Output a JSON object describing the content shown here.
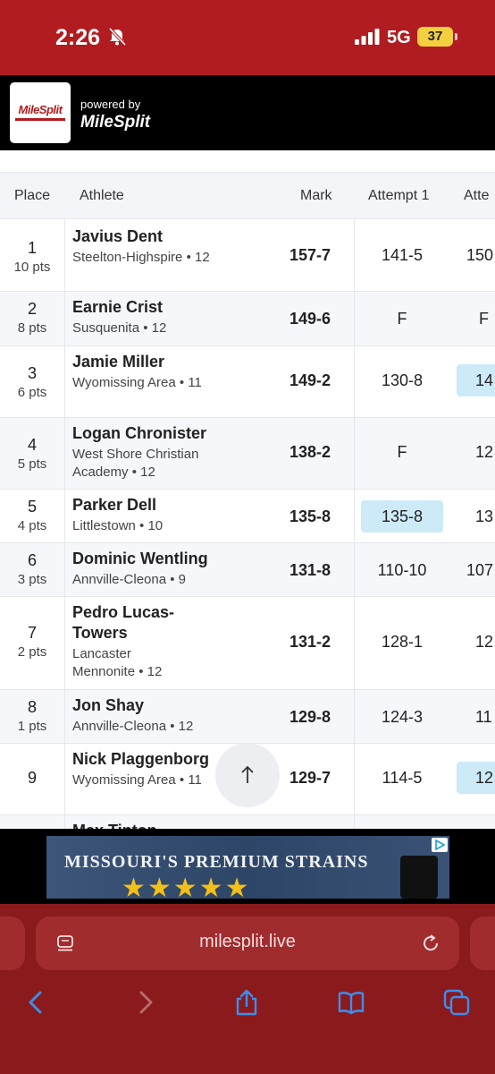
{
  "status_bar": {
    "time": "2:26",
    "network": "5G",
    "battery": "37"
  },
  "header": {
    "logo_text": "MileSplit",
    "powered_by": "powered by",
    "powered_brand": "MileSplit"
  },
  "table": {
    "columns": {
      "place": "Place",
      "athlete": "Athlete",
      "mark": "Mark",
      "attempt1": "Attempt 1",
      "attempt2": "Atte"
    },
    "rows": [
      {
        "place": "1",
        "pts": "10 pts",
        "name": "Javius Dent",
        "team": "Steelton-Highspire • 12",
        "mark": "157-7",
        "att1": "141-5",
        "att2": "150"
      },
      {
        "place": "2",
        "pts": "8 pts",
        "name": "Earnie Crist",
        "team": "Susquenita • 12",
        "mark": "149-6",
        "att1": "F",
        "att2": "F"
      },
      {
        "place": "3",
        "pts": "6 pts",
        "name": "Jamie Miller",
        "team": "Wyomissing Area • 11",
        "mark": "149-2",
        "att1": "130-8",
        "att2": "14"
      },
      {
        "place": "4",
        "pts": "5 pts",
        "name": "Logan Chronister",
        "team": "West Shore Christian Academy • 12",
        "mark": "138-2",
        "att1": "F",
        "att2": "12"
      },
      {
        "place": "5",
        "pts": "4 pts",
        "name": "Parker Dell",
        "team": "Littlestown • 10",
        "mark": "135-8",
        "att1": "135-8",
        "att2": "13"
      },
      {
        "place": "6",
        "pts": "3 pts",
        "name": "Dominic Wentling",
        "team": "Annville-Cleona • 9",
        "mark": "131-8",
        "att1": "110-10",
        "att2": "107"
      },
      {
        "place": "7",
        "pts": "2 pts",
        "name": "Pedro Lucas-Towers",
        "team": "Lancaster Mennonite • 12",
        "mark": "131-2",
        "att1": "128-1",
        "att2": "12"
      },
      {
        "place": "8",
        "pts": "1 pts",
        "name": "Jon Shay",
        "team": "Annville-Cleona • 12",
        "mark": "129-8",
        "att1": "124-3",
        "att2": "11"
      },
      {
        "place": "9",
        "pts": "",
        "name": "Nick Plaggenborg",
        "team": "Wyomissing Area • 11",
        "mark": "129-7",
        "att1": "114-5",
        "att2": "12"
      },
      {
        "place": "",
        "pts": "",
        "name": "Max Tinton",
        "team": "",
        "mark": "",
        "att1": "",
        "att2": ""
      }
    ]
  },
  "ad": {
    "text": "MISSOURI'S PREMIUM STRAINS",
    "stars": "★★★★★"
  },
  "browser": {
    "url": "milesplit.live"
  },
  "colors": {
    "status_bar": "#b01c1f",
    "browser_bar": "#8b1a1c",
    "highlight": "#cdeaf8"
  },
  "icons": [
    "bell-slash-icon",
    "signal-icon",
    "reader-icon",
    "reload-icon",
    "back-icon",
    "forward-icon",
    "share-icon",
    "bookmarks-icon",
    "tabs-icon",
    "arrow-up-icon"
  ]
}
